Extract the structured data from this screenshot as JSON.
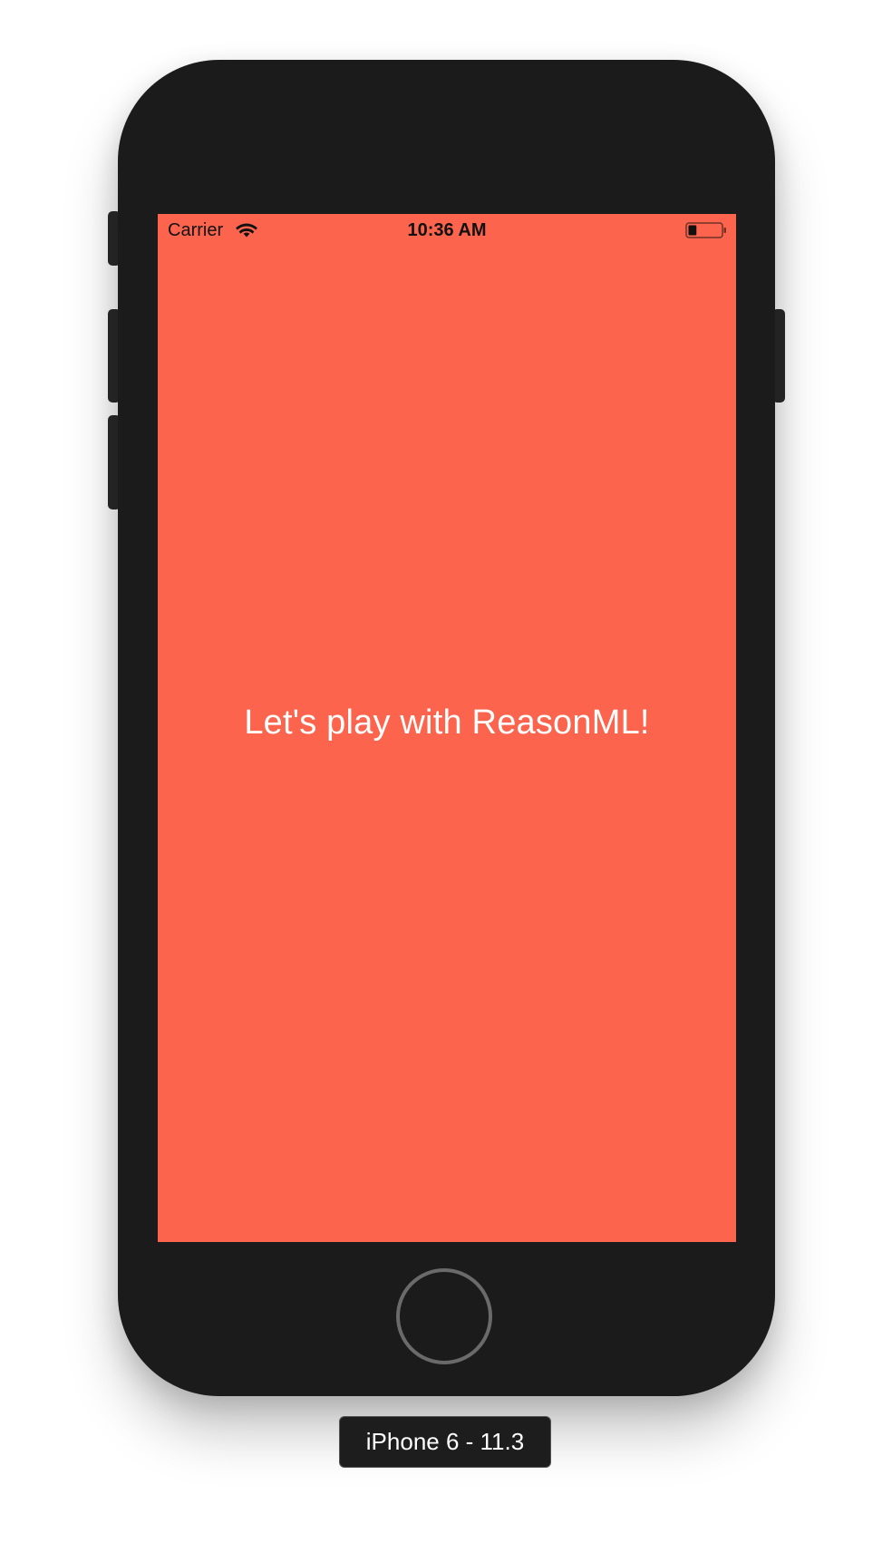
{
  "status_bar": {
    "carrier": "Carrier",
    "wifi_icon": "wifi-icon",
    "time": "10:36 AM",
    "battery_icon": "battery-icon",
    "battery_level": 0.25
  },
  "app": {
    "message": "Let's play with ReasonML!",
    "background_color": "#fc644d",
    "text_color": "#ffffff"
  },
  "device": {
    "label": "iPhone 6 - 11.3",
    "body_color": "#1b1b1b",
    "home_button_icon": "home-button-icon"
  }
}
